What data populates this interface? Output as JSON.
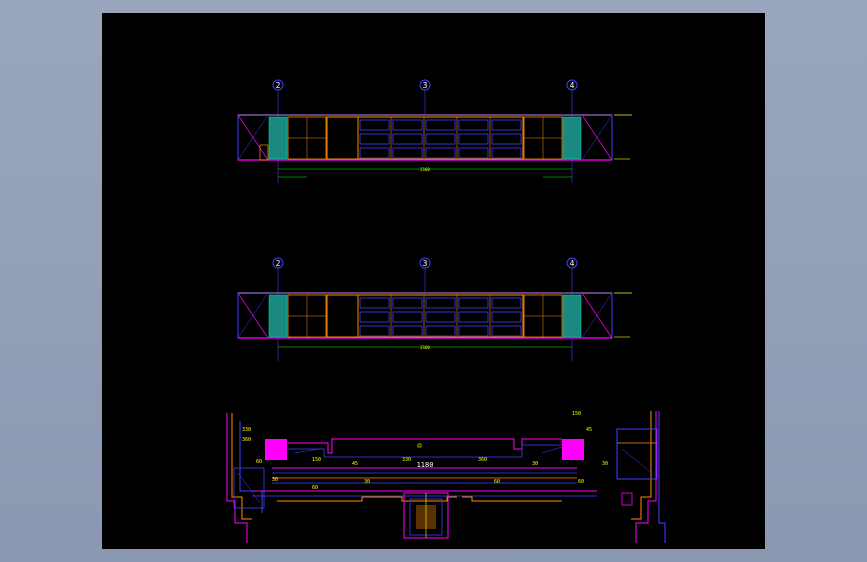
{
  "colors": {
    "background": "#8f9bb4",
    "canvas": "#000000",
    "outline": "#3f3fff",
    "trim": "#ff00ff",
    "wood": "#ff8c00",
    "panel": "#1a8a80",
    "dim": "#00ff00",
    "text": "#ffff00"
  },
  "elevations": [
    {
      "axis_labels": [
        "2",
        "3",
        "4"
      ],
      "center_dim": "2160"
    },
    {
      "axis_labels": [
        "2",
        "3",
        "4"
      ],
      "center_dim": "2160"
    }
  ],
  "section": {
    "center_dim": "1180",
    "dims": [
      "330",
      "360",
      "60",
      "30",
      "150",
      "60",
      "45",
      "30"
    ]
  }
}
